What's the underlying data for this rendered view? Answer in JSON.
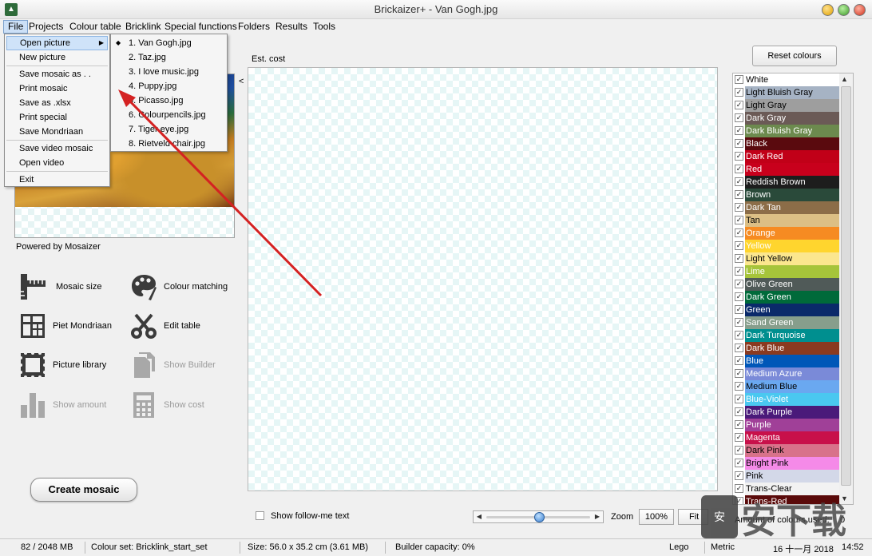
{
  "window": {
    "title": "Brickaizer+  - Van Gogh.jpg",
    "icon": "app-icon"
  },
  "menubar": [
    "File",
    "Projects",
    "Colour table",
    "Bricklink",
    "Special functions",
    "Folders",
    "Results",
    "Tools"
  ],
  "file_menu": {
    "items": [
      {
        "label": "Open picture",
        "highlighted": true,
        "has_submenu": true
      },
      {
        "label": "New picture"
      },
      {
        "label": "Save mosaic as . ."
      },
      {
        "label": "Print mosaic"
      },
      {
        "label": "Save as .xlsx"
      },
      {
        "label": "Print special"
      },
      {
        "label": "Save Mondriaan"
      },
      {
        "label": "Save video mosaic"
      },
      {
        "label": "Open video"
      },
      {
        "label": "Exit"
      }
    ]
  },
  "recent_files": [
    "1.  Van Gogh.jpg",
    "2.  Taz.jpg",
    "3.  I love music.jpg",
    "4.  Puppy.jpg",
    "5.  Picasso.jpg",
    "6.  Colourpencils.jpg",
    "7.  Tiger eye.jpg",
    "8.  Rietveld chair.jpg"
  ],
  "left_panel": {
    "collapse_arrow": "<",
    "powered_by": "Powered by Mosaizer",
    "tools": [
      {
        "label": "Mosaic size",
        "icon": "ruler-icon",
        "enabled": true
      },
      {
        "label": "Colour matching",
        "icon": "palette-icon",
        "enabled": true
      },
      {
        "label": "Piet Mondriaan",
        "icon": "grid-icon",
        "enabled": true
      },
      {
        "label": "Edit table",
        "icon": "scissors-icon",
        "enabled": true
      },
      {
        "label": "Picture library",
        "icon": "stamp-icon",
        "enabled": true
      },
      {
        "label": "Show Builder",
        "icon": "documents-icon",
        "enabled": false
      },
      {
        "label": "Show amount",
        "icon": "bar-chart-icon",
        "enabled": false
      },
      {
        "label": "Show cost",
        "icon": "calculator-icon",
        "enabled": false
      }
    ],
    "create_button": "Create mosaic"
  },
  "canvas": {
    "est_cost_label": "Est. cost"
  },
  "bottom_controls": {
    "follow_me_label": "Show follow-me text",
    "zoom_label": "Zoom",
    "zoom_value": "100%",
    "fit_label": "Fit",
    "zoom_slider_fraction": 0.5
  },
  "colours_panel": {
    "reset_button": "Reset colours",
    "amount_label": "Amount of colours used:",
    "amount_value": "0",
    "colours": [
      {
        "name": "White",
        "color": "#ffffff",
        "text": "#000000"
      },
      {
        "name": "Light Bluish Gray",
        "color": "#a6b3c4",
        "text": "#000000"
      },
      {
        "name": "Light Gray",
        "color": "#9e9e9e",
        "text": "#000000"
      },
      {
        "name": "Dark Gray",
        "color": "#6b5a56",
        "text": "#ffffff"
      },
      {
        "name": "Dark Bluish Gray",
        "color": "#6c8a4e",
        "text": "#ffffff"
      },
      {
        "name": "Black",
        "color": "#5a0a0e",
        "text": "#ffffff"
      },
      {
        "name": "Dark Red",
        "color": "#c10018",
        "text": "#ffffff"
      },
      {
        "name": "Red",
        "color": "#c8001c",
        "text": "#ffffff"
      },
      {
        "name": "Reddish Brown",
        "color": "#1d1d1d",
        "text": "#ffffff"
      },
      {
        "name": "Brown",
        "color": "#2a4a3a",
        "text": "#ffffff"
      },
      {
        "name": "Dark Tan",
        "color": "#8c6d48",
        "text": "#ffffff"
      },
      {
        "name": "Tan",
        "color": "#dcbf85",
        "text": "#000000"
      },
      {
        "name": "Orange",
        "color": "#f68b22",
        "text": "#ffffff"
      },
      {
        "name": "Yellow",
        "color": "#ffd52e",
        "text": "#ffffff"
      },
      {
        "name": "Light Yellow",
        "color": "#fbe68e",
        "text": "#000000"
      },
      {
        "name": "Lime",
        "color": "#a6c43a",
        "text": "#ffffff"
      },
      {
        "name": "Olive Green",
        "color": "#505a58",
        "text": "#ffffff"
      },
      {
        "name": "Dark Green",
        "color": "#006a3a",
        "text": "#ffffff"
      },
      {
        "name": "Green",
        "color": "#0a2a6a",
        "text": "#ffffff"
      },
      {
        "name": "Sand Green",
        "color": "#879e8c",
        "text": "#ffffff"
      },
      {
        "name": "Dark Turquoise",
        "color": "#008f8f",
        "text": "#ffffff"
      },
      {
        "name": "Dark Blue",
        "color": "#8a3a20",
        "text": "#ffffff"
      },
      {
        "name": "Blue",
        "color": "#0057b8",
        "text": "#ffffff"
      },
      {
        "name": "Medium Azure",
        "color": "#7a8ad8",
        "text": "#ffffff"
      },
      {
        "name": "Medium Blue",
        "color": "#6aa8f0",
        "text": "#000000"
      },
      {
        "name": "Blue-Violet",
        "color": "#4ac8f0",
        "text": "#ffffff"
      },
      {
        "name": "Dark Purple",
        "color": "#4a1a7a",
        "text": "#ffffff"
      },
      {
        "name": "Purple",
        "color": "#a04098",
        "text": "#ffffff"
      },
      {
        "name": "Magenta",
        "color": "#c8104a",
        "text": "#ffffff"
      },
      {
        "name": "Dark Pink",
        "color": "#d8728a",
        "text": "#000000"
      },
      {
        "name": "Bright Pink",
        "color": "#f58ae8",
        "text": "#000000"
      },
      {
        "name": "Pink",
        "color": "#d3d8e8",
        "text": "#000000"
      },
      {
        "name": "Trans-Clear",
        "color": "#f2f2f2",
        "text": "#000000"
      },
      {
        "name": "Trans-Red",
        "color": "#5a0a0a",
        "text": "#ffffff"
      }
    ]
  },
  "statusbar": {
    "memory": "82 / 2048 MB",
    "colour_set": "Colour set: Bricklink_start_set",
    "size": "Size: 56.0 x 35.2 cm (3.61 MB)",
    "builder_capacity": "Builder capacity: 0%",
    "brand": "Lego",
    "unit": "Metric",
    "date": "16 十一月 2018",
    "time": "14:52"
  },
  "watermark": {
    "text": "安下载",
    "badge": "安"
  },
  "annotation_color": "#d42222"
}
